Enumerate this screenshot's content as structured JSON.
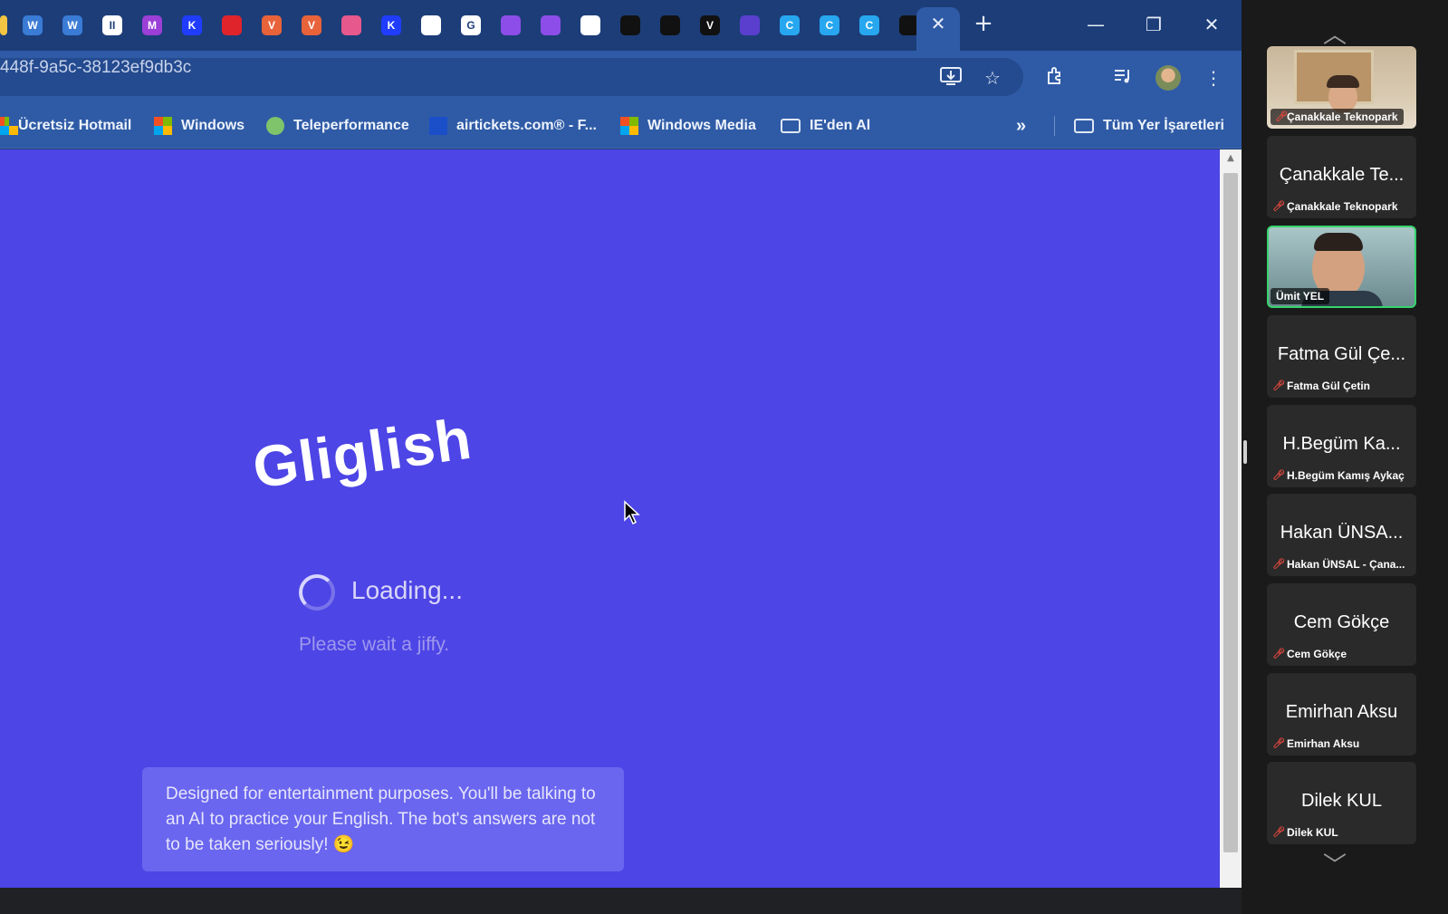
{
  "browser": {
    "address": "448f-9a5c-38123ef9db3c",
    "tab_close_glyph": "✕",
    "new_tab_glyph": "+",
    "window_controls": {
      "minimize": "—",
      "restore": "❐",
      "close": "✕"
    },
    "tab_icons": [
      {
        "letter": "",
        "color": "#f4c542"
      },
      {
        "letter": "W",
        "color": "#3a7bd5"
      },
      {
        "letter": "W",
        "color": "#3a7bd5"
      },
      {
        "letter": "II",
        "color": "#ffffff"
      },
      {
        "letter": "M",
        "color": "#9b3fd6"
      },
      {
        "letter": "K",
        "color": "#1f3cff"
      },
      {
        "letter": "",
        "color": "#e0242b"
      },
      {
        "letter": "V",
        "color": "#e8623a"
      },
      {
        "letter": "V",
        "color": "#e8623a"
      },
      {
        "letter": "",
        "color": "#e7588c"
      },
      {
        "letter": "K",
        "color": "#1f3cff"
      },
      {
        "letter": "",
        "color": "#ffffff"
      },
      {
        "letter": "G",
        "color": "#ffffff"
      },
      {
        "letter": "",
        "color": "#8d4de8"
      },
      {
        "letter": "",
        "color": "#8d4de8"
      },
      {
        "letter": "",
        "color": "#ffffff"
      },
      {
        "letter": "",
        "color": "#111111"
      },
      {
        "letter": "",
        "color": "#111111"
      },
      {
        "letter": "V",
        "color": "#111111"
      },
      {
        "letter": "",
        "color": "#5a3fcf"
      },
      {
        "letter": "C",
        "color": "#27a7f0"
      },
      {
        "letter": "C",
        "color": "#27a7f0"
      },
      {
        "letter": "C",
        "color": "#27a7f0"
      },
      {
        "letter": "",
        "color": "#111111"
      }
    ],
    "bookmarks": [
      {
        "label": "Ücretsiz Hotmail",
        "icon": "microsoft-icon"
      },
      {
        "label": "Windows",
        "icon": "microsoft-icon"
      },
      {
        "label": "Teleperformance",
        "icon": "teleperformance-icon"
      },
      {
        "label": "airtickets.com® - F...",
        "icon": "airtickets-icon"
      },
      {
        "label": "Windows Media",
        "icon": "microsoft-icon"
      },
      {
        "label": "IE'den Al",
        "icon": "folder-icon"
      }
    ],
    "bookmarks_overflow": "»",
    "all_bookmarks": "Tüm Yer İşaretleri"
  },
  "page": {
    "logo": "Gliglish",
    "loading": "Loading...",
    "wait": "Please wait a jiffy.",
    "notice": "Designed for entertainment purposes. You'll be talking to an AI to practice your English. The bot's answers are not to be taken seriously! 😉"
  },
  "participants": [
    {
      "big": "",
      "name": "Çanakkale Teknopark",
      "video": true,
      "muted": true
    },
    {
      "big": "Çanakkale Te...",
      "name": "Çanakkale Teknopark",
      "video": false,
      "muted": true
    },
    {
      "big": "",
      "name": "Ümit YEL",
      "video": true,
      "muted": false
    },
    {
      "big": "Fatma Gül Çe...",
      "name": "Fatma Gül Çetin",
      "video": false,
      "muted": true
    },
    {
      "big": "H.Begüm Ka...",
      "name": "H.Begüm Kamış Aykaç",
      "video": false,
      "muted": true
    },
    {
      "big": "Hakan ÜNSA...",
      "name": "Hakan ÜNSAL - Çana...",
      "video": false,
      "muted": true
    },
    {
      "big": "Cem Gökçe",
      "name": "Cem Gökçe",
      "video": false,
      "muted": true
    },
    {
      "big": "Emirhan Aksu",
      "name": "Emirhan Aksu",
      "video": false,
      "muted": true
    },
    {
      "big": "Dilek KUL",
      "name": "Dilek KUL",
      "video": false,
      "muted": true
    }
  ],
  "panel": {
    "scroll_up": "︿",
    "scroll_down": "﹀"
  }
}
